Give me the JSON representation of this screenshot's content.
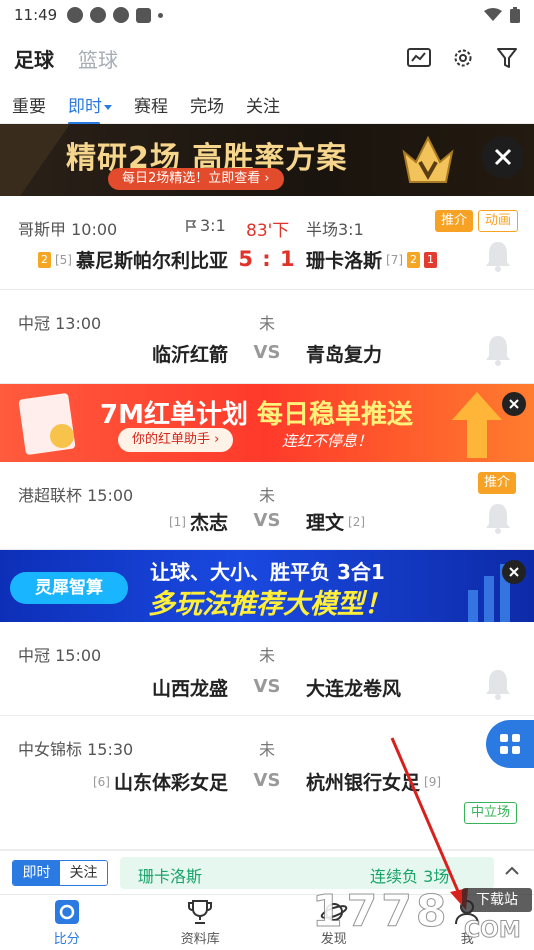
{
  "status_bar": {
    "time": "11:49"
  },
  "sport_tabs": [
    {
      "label": "足球"
    },
    {
      "label": "篮球"
    }
  ],
  "sub_tabs": [
    {
      "label": "重要"
    },
    {
      "label": "即时"
    },
    {
      "label": "赛程"
    },
    {
      "label": "完场"
    },
    {
      "label": "关注"
    }
  ],
  "banner1": {
    "title": "精研2场 高胜率方案",
    "subtitle": "每日2场精选！立即查看 ›"
  },
  "banner2": {
    "title_a": "7M红单计划 ",
    "title_b": "每日稳单推送",
    "pill": "你的红单助手 ›",
    "tail": "连红不停息！"
  },
  "banner3": {
    "tag": "灵犀智算",
    "line1": "让球、大小、胜平负 3合1",
    "line2": "多玩法推荐大模型！"
  },
  "matches": [
    {
      "league": "哥斯甲 10:00",
      "corner": "3:1",
      "minute": "83'下",
      "half": "半场3:1",
      "home": "慕尼斯帕尔利比亚",
      "home_rank": "[5]",
      "home_yellow": "2",
      "away": "珊卡洛斯",
      "away_rank": "[7]",
      "away_yellow": "2",
      "away_red": "1",
      "score": "5 : 1",
      "badge1": "推介",
      "badge2": "动画"
    },
    {
      "league": "中冠 13:00",
      "status": "未",
      "home": "临沂红箭",
      "vs": "VS",
      "away": "青岛复力"
    },
    {
      "league": "港超联杯 15:00",
      "status": "未",
      "home": "杰志",
      "home_rank": "[1]",
      "vs": "VS",
      "away": "理文",
      "away_rank": "[2]",
      "badge1": "推介"
    },
    {
      "league": "中冠 15:00",
      "status": "未",
      "home": "山西龙盛",
      "vs": "VS",
      "away": "大连龙卷风"
    },
    {
      "league": "中女锦标 15:30",
      "status": "未",
      "home": "山东体彩女足",
      "home_rank": "[6]",
      "vs": "VS",
      "away": "杭州银行女足",
      "away_rank": "[9]",
      "badge1": "中立场"
    }
  ],
  "ticker": {
    "seg_on": "即时",
    "seg_off": "关注",
    "team": "珊卡洛斯",
    "text": "连续负 3场"
  },
  "bottom_nav": [
    {
      "label": "比分"
    },
    {
      "label": "资料库"
    },
    {
      "label": "发现"
    },
    {
      "label": "我"
    }
  ],
  "watermark": {
    "digits": "1778",
    "label": "下载站",
    "com": "COM"
  },
  "colors": {
    "accent": "#2a7ae2",
    "score_red": "#e0332a",
    "badge_orange": "#f7a225",
    "ticker_green": "#19a36a"
  }
}
